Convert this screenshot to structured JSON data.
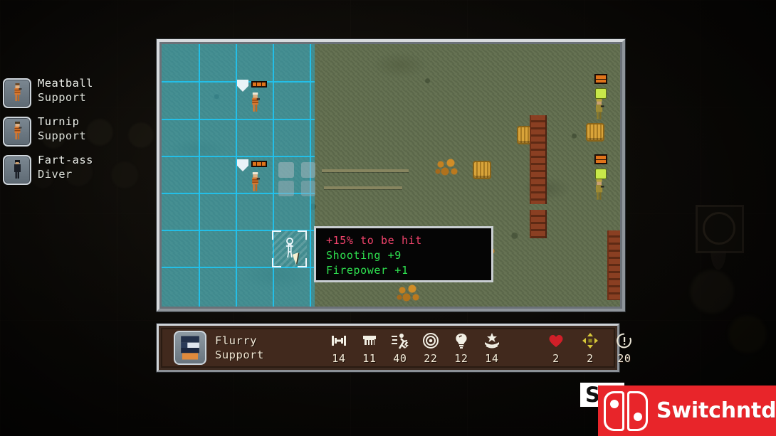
{
  "roster": {
    "items": [
      {
        "name": "Meatball",
        "role": "Support",
        "portrait": "soldier-orange-portrait"
      },
      {
        "name": "Turnip",
        "role": "Support",
        "portrait": "soldier-orange-portrait"
      },
      {
        "name": "Fart-ass",
        "role": "Diver",
        "portrait": "diver-dark-portrait"
      }
    ]
  },
  "map": {
    "name": "tactical-battle-map",
    "terrain": "grass-field",
    "range_overlay_color": "#28aacd",
    "grid_color": "#21c3f0",
    "selected_tile": {
      "label": "selected-tile",
      "cursor": "mouse-cursor"
    },
    "friendly_units": [
      {
        "id": "unit-north",
        "hp_segments": 3,
        "marker": "shield-marker"
      },
      {
        "id": "unit-south",
        "hp_segments": 3,
        "marker": "shield-marker"
      }
    ],
    "enemy_units": [
      {
        "id": "enemy-1",
        "marker": "enemy-marker"
      },
      {
        "id": "enemy-2",
        "marker": "enemy-marker"
      }
    ]
  },
  "tooltip": {
    "name": "combat-preview-tooltip",
    "lines": [
      {
        "text": "+15% to be hit",
        "color": "#f0436b"
      },
      {
        "text": "Shooting +9",
        "color": "#2ee04f"
      },
      {
        "text": "Firepower +1",
        "color": "#2ee04f"
      }
    ]
  },
  "statbar": {
    "unit_name": "Flurry",
    "unit_role": "Support",
    "portrait": "flurry-portrait",
    "primary_stats": [
      {
        "icon": "dumbbell-icon",
        "label": "Strength",
        "value": "14"
      },
      {
        "icon": "anvil-icon",
        "label": "Melee",
        "value": "11"
      },
      {
        "icon": "running-figure-icon",
        "label": "Speed",
        "value": "40"
      },
      {
        "icon": "target-icon",
        "label": "Shooting",
        "value": "22"
      },
      {
        "icon": "lightbulb-icon",
        "label": "Intellect",
        "value": "12"
      },
      {
        "icon": "star-crown-icon",
        "label": "Morale",
        "value": "14"
      }
    ],
    "secondary_stats": [
      {
        "icon": "heart-icon",
        "label": "Health",
        "value": "2",
        "color": "#d01f28"
      },
      {
        "icon": "move-arrows-icon",
        "label": "Movement",
        "value": "2",
        "color": "#d7c83a"
      },
      {
        "icon": "action-timer-icon",
        "label": "Actions",
        "value": "20",
        "color": "#e9e4d4"
      }
    ]
  },
  "background": {
    "star_badge": "star-emblem-badge"
  },
  "watermark": {
    "partial_letter": "S",
    "site": "Switchntd.com",
    "logo": "nintendo-switch-logo",
    "brand_color": "#e8252a"
  }
}
